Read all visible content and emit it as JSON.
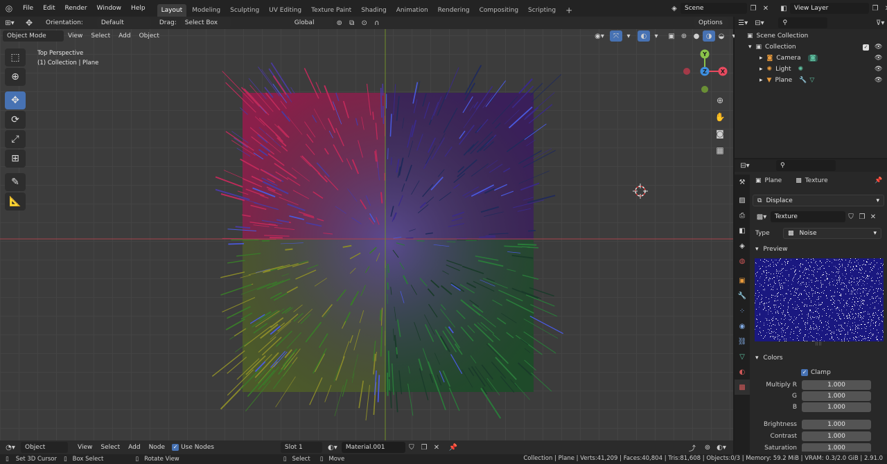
{
  "topbar": {
    "menus": [
      "File",
      "Edit",
      "Render",
      "Window",
      "Help"
    ],
    "workspaces": [
      "Layout",
      "Modeling",
      "Sculpting",
      "UV Editing",
      "Texture Paint",
      "Shading",
      "Animation",
      "Rendering",
      "Compositing",
      "Scripting"
    ],
    "active_workspace": "Layout",
    "scene": "Scene",
    "view_layer": "View Layer"
  },
  "tool_header": {
    "orientation_label": "Orientation:",
    "orientation_value": "Default",
    "drag_label": "Drag:",
    "drag_value": "Select Box",
    "transform_orientation": "Global",
    "options_label": "Options"
  },
  "viewport_header": {
    "mode": "Object Mode",
    "menus": [
      "View",
      "Select",
      "Add",
      "Object"
    ]
  },
  "viewport": {
    "view_name": "Top Perspective",
    "collection_info": "(1) Collection | Plane",
    "gizmo": {
      "x": "X",
      "y": "Y",
      "z": "Z"
    }
  },
  "outliner": {
    "root": "Scene Collection",
    "collection": "Collection",
    "items": [
      "Camera",
      "Light",
      "Plane"
    ]
  },
  "properties": {
    "object": "Plane",
    "texture_tab": "Texture",
    "modifier": "Displace",
    "texture_name": "Texture",
    "type_label": "Type",
    "type_value": "Noise",
    "preview_label": "Preview",
    "colors_label": "Colors",
    "clamp_label": "Clamp",
    "rows": [
      {
        "label": "Multiply R",
        "value": "1.000"
      },
      {
        "label": "G",
        "value": "1.000"
      },
      {
        "label": "B",
        "value": "1.000"
      }
    ],
    "rows2": [
      {
        "label": "Brightness",
        "value": "1.000"
      },
      {
        "label": "Contrast",
        "value": "1.000"
      },
      {
        "label": "Saturation",
        "value": "1.000"
      }
    ]
  },
  "shader_header": {
    "object_value": "Object",
    "menus": [
      "View",
      "Select",
      "Add",
      "Node"
    ],
    "use_nodes": "Use Nodes",
    "slot": "Slot 1",
    "material": "Material.001"
  },
  "statusbar": {
    "set_cursor": "Set 3D Cursor",
    "box_select": "Box Select",
    "rotate_view": "Rotate View",
    "select": "Select",
    "move": "Move",
    "stats": "Collection | Plane | Verts:41,209 | Faces:40,804 | Tris:81,608 | Objects:0/3 | Memory: 59.2 MiB | VRAM: 0.3/2.0 GiB | 2.91.0"
  },
  "colors": {
    "accent": "#4772b3",
    "x_axis": "#e84a5f",
    "y_axis": "#8bc34a",
    "z_axis": "#3d8fe0",
    "preview_bg": "#1a1880"
  }
}
